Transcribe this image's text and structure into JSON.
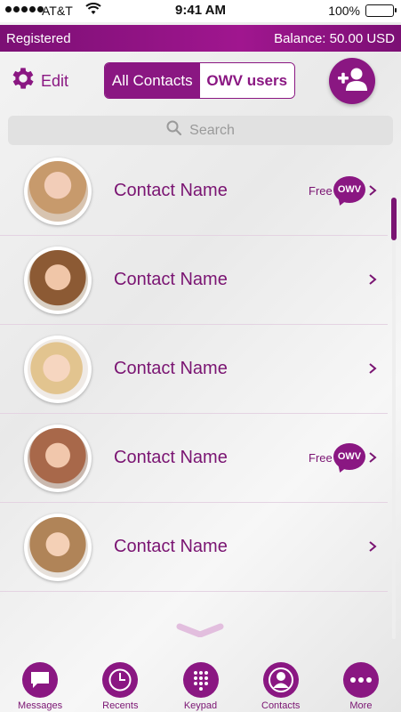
{
  "status_bar": {
    "carrier": "AT&T",
    "time": "9:41 AM",
    "battery": "100%"
  },
  "info_bar": {
    "status": "Registered",
    "balance": "Balance: 50.00 USD"
  },
  "toolbar": {
    "edit_label": "Edit",
    "segments": [
      "All Contacts",
      "OWV users"
    ],
    "active_segment": "All Contacts"
  },
  "search": {
    "placeholder": "Search"
  },
  "contacts": [
    {
      "name": "Contact Name",
      "free_label": "Free",
      "badge": "OWV",
      "owv_user": true
    },
    {
      "name": "Contact Name",
      "owv_user": false
    },
    {
      "name": "Contact Name",
      "owv_user": false
    },
    {
      "name": "Contact Name",
      "free_label": "Free",
      "badge": "OWV",
      "owv_user": true
    },
    {
      "name": "Contact Name",
      "owv_user": false
    }
  ],
  "tabs": [
    {
      "label": "Messages",
      "icon": "message-icon"
    },
    {
      "label": "Recents",
      "icon": "clock-icon"
    },
    {
      "label": "Keypad",
      "icon": "keypad-icon"
    },
    {
      "label": "Contacts",
      "icon": "contacts-icon",
      "active": true
    },
    {
      "label": "More",
      "icon": "more-icon"
    }
  ],
  "colors": {
    "brand_purple": "#8a1782",
    "text_purple": "#7a1472"
  }
}
